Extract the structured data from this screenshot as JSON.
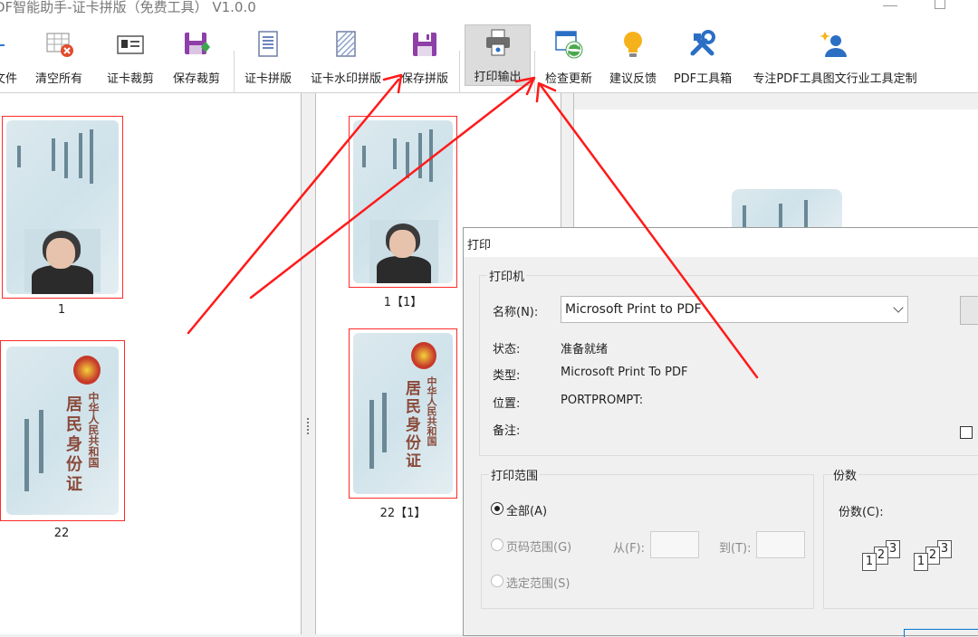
{
  "window": {
    "title": "DF智能助手-证卡拼版（免费工具） V1.0.0"
  },
  "toolbar": {
    "items": [
      {
        "label": "文件",
        "icon": "add-file-icon"
      },
      {
        "label": "清空所有",
        "icon": "clear-all-icon"
      },
      {
        "label": "证卡裁剪",
        "icon": "id-card-icon"
      },
      {
        "label": "保存裁剪",
        "icon": "save-export-icon"
      },
      {
        "label": "证卡拼版",
        "icon": "layout-document-icon"
      },
      {
        "label": "证卡水印拼版",
        "icon": "watermark-document-icon"
      },
      {
        "label": "保存拼版",
        "icon": "save-icon"
      },
      {
        "label": "打印输出",
        "icon": "printer-icon"
      },
      {
        "label": "检查更新",
        "icon": "update-check-icon"
      },
      {
        "label": "建议反馈",
        "icon": "lightbulb-icon"
      },
      {
        "label": "PDF工具箱",
        "icon": "tools-icon"
      },
      {
        "label": "专注PDF工具图文行业工具定制",
        "icon": "user-custom-icon"
      }
    ]
  },
  "left_panel": {
    "items": [
      {
        "label": "1"
      },
      {
        "label": "22"
      }
    ]
  },
  "middle_panel": {
    "items": [
      {
        "label": "1【1】"
      },
      {
        "label": "22【1】"
      }
    ]
  },
  "id_card_back": {
    "title": "中华人民共和国",
    "subtitle": "居民身份证"
  },
  "print_dialog": {
    "title": "打印",
    "printer_group": "打印机",
    "name_label": "名称(N):",
    "name_value": "Microsoft Print to PDF",
    "status_label": "状态:",
    "status_value": "准备就绪",
    "type_label": "类型:",
    "type_value": "Microsoft Print To PDF",
    "location_label": "位置:",
    "location_value": "PORTPROMPT:",
    "comment_label": "备注:",
    "range_group": "打印范围",
    "range_all": "全部(A)",
    "range_pages": "页码范围(G)",
    "from_label": "从(F):",
    "to_label": "到(T):",
    "range_selection": "选定范围(S)",
    "copies_group": "份数",
    "copies_label": "份数(C):",
    "collate_pages": [
      "1",
      "2",
      "3"
    ]
  },
  "colors": {
    "highlight_border": "#ff2a2a",
    "annotation_arrow": "#ff1a1a",
    "accent": "#0078d7"
  }
}
